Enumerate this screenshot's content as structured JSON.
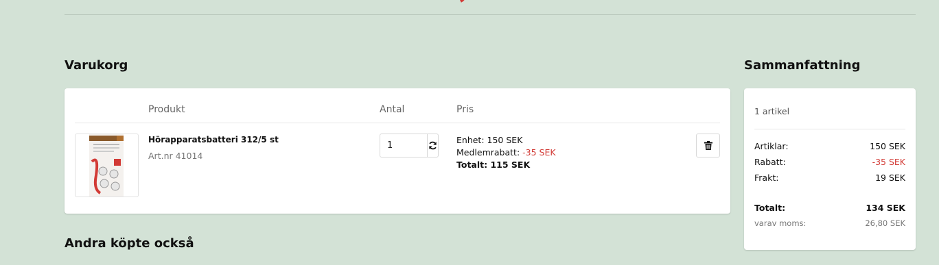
{
  "colors": {
    "background": "#d3e2d6",
    "card": "#ffffff",
    "accent_red": "#d23a35",
    "muted_text": "#777777"
  },
  "cart": {
    "title": "Varukorg",
    "columns": {
      "product": "Produkt",
      "quantity": "Antal",
      "price": "Pris"
    },
    "items": [
      {
        "name": "Hörapparatsbatteri 312/5 st",
        "article": "Art.nr 41014",
        "quantity": "1",
        "unit_label": "Enhet:",
        "unit_price": "150 SEK",
        "member_discount_label": "Medlemrabatt:",
        "member_discount": "-35 SEK",
        "total_label": "Totalt:",
        "total": "115 SEK",
        "image_icon": "battery-package-image",
        "refresh_icon": "refresh-icon",
        "delete_icon": "trash-icon"
      }
    ]
  },
  "summary": {
    "title": "Sammanfattning",
    "count": "1 artikel",
    "rows": [
      {
        "label": "Artiklar:",
        "value": "150 SEK"
      },
      {
        "label": "Rabatt:",
        "value": "-35 SEK"
      },
      {
        "label": "Frakt:",
        "value": "19 SEK"
      }
    ],
    "total_label": "Totalt:",
    "total_value": "134 SEK",
    "vat_label": "varav moms:",
    "vat_value": "26,80 SEK"
  },
  "also_bought": {
    "title": "Andra köpte också"
  }
}
